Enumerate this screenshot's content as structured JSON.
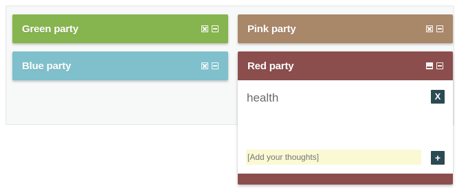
{
  "panels": {
    "green": {
      "title": "Green party",
      "color": "#86b44f"
    },
    "pink": {
      "title": "Pink party",
      "color": "#a98769"
    },
    "blue": {
      "title": "Blue party",
      "color": "#7fc0cc"
    },
    "red": {
      "title": "Red party",
      "color": "#8b4e4d",
      "topic": "health",
      "remove_label": "X",
      "thought_placeholder": "[Add your thoughts]",
      "add_label": "+"
    }
  },
  "colors": {
    "button_bg": "#2c4a52",
    "input_bg": "#fbf9d4"
  },
  "icons": [
    "close-square-icon",
    "expand-square-icon",
    "minimize-square-icon",
    "restore-square-icon"
  ]
}
